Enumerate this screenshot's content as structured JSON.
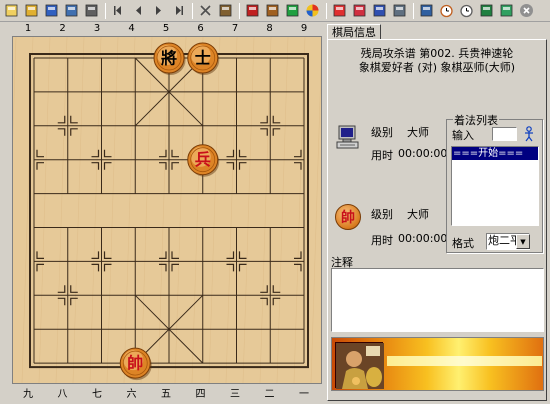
{
  "toolbar": {
    "icons": [
      "new-file-icon",
      "open-folder-icon",
      "save-icon",
      "copy-board-icon",
      "print-icon",
      "first-move-icon",
      "previous-move-icon",
      "next-move-icon",
      "last-move-icon",
      "delete-move-icon",
      "paste-icon",
      "red-book-icon",
      "setup-board-icon",
      "board-colors-icon",
      "color-wheel-icon",
      "eye-settings-icon",
      "watch-icon",
      "load-game-icon",
      "notes-icon",
      "book-icon",
      "timer-icon",
      "clock-icon",
      "monitor-icon",
      "picture-icon",
      "close-icon"
    ]
  },
  "board": {
    "top_coords": [
      "1",
      "2",
      "3",
      "4",
      "5",
      "6",
      "7",
      "8",
      "9"
    ],
    "bottom_coords": [
      "九",
      "八",
      "七",
      "六",
      "五",
      "四",
      "三",
      "二",
      "一"
    ],
    "pieces": [
      {
        "name": "black-general",
        "glyph": "將",
        "side": "black",
        "file": 4,
        "rank": 0
      },
      {
        "name": "black-advisor",
        "glyph": "士",
        "side": "black",
        "file": 5,
        "rank": 0
      },
      {
        "name": "red-soldier",
        "glyph": "兵",
        "side": "red",
        "file": 5,
        "rank": 3
      },
      {
        "name": "red-general",
        "glyph": "帥",
        "side": "red",
        "file": 3,
        "rank": 9
      }
    ],
    "colors": {
      "wood": "#e6c998",
      "line": "#3a2a1a",
      "red_text": "#c8101a",
      "black_text": "#000000"
    }
  },
  "panel": {
    "tab_label": "棋局信息",
    "title_line1": "残局攻杀谱 第002. 兵贵神速轮",
    "title_line2": "象棋爱好者 (对) 象棋巫师(大师)",
    "top_player": {
      "rank_label": "级别",
      "rank_value": "大师",
      "time_label": "用时",
      "time_value": "00:00:00"
    },
    "bottom_player": {
      "avatar_glyph": "帥",
      "rank_label": "级别",
      "rank_value": "大师",
      "time_label": "用时",
      "time_value": "00:00:00"
    },
    "moves": {
      "title": "着法列表",
      "input_label": "输入",
      "input_value": "",
      "items": [
        "===开始==="
      ],
      "format_label": "格式",
      "format_value": "炮二平五"
    },
    "notes": {
      "label": "注释",
      "value": ""
    }
  }
}
